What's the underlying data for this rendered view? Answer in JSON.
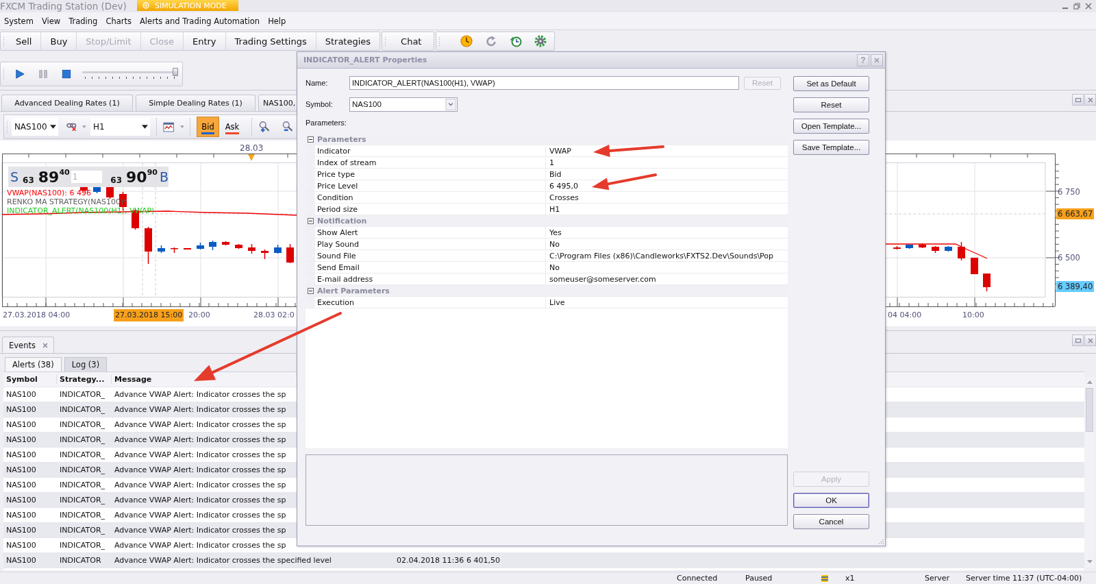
{
  "window": {
    "title": "FXCM Trading Station (Dev)",
    "mode_badge": "SIMULATION MODE"
  },
  "menu": [
    {
      "label": "System"
    },
    {
      "label": "View"
    },
    {
      "label": "Trading"
    },
    {
      "label": "Charts"
    },
    {
      "label": "Alerts and Trading Automation"
    },
    {
      "label": "Help"
    }
  ],
  "toolbar": {
    "trade_buttons": [
      {
        "label": "Sell",
        "disabled": false
      },
      {
        "label": "Buy",
        "disabled": false
      },
      {
        "label": "Stop/Limit",
        "disabled": true
      },
      {
        "label": "Close",
        "disabled": true
      },
      {
        "label": "Entry",
        "disabled": false
      },
      {
        "label": "Trading Settings",
        "disabled": false
      },
      {
        "label": "Strategies",
        "disabled": false
      }
    ],
    "chat_button": "Chat"
  },
  "playback": {
    "level": 1
  },
  "chart_panel": {
    "tabs": [
      {
        "label": "Advanced Dealing Rates (1)"
      },
      {
        "label": "Simple Dealing Rates (1)"
      },
      {
        "label": "NAS100,"
      }
    ],
    "toolbar": {
      "symbol": "NAS100",
      "period": "H1",
      "price_buttons": [
        {
          "label": "Bid",
          "selected": true
        },
        {
          "label": "Ask",
          "selected": false
        }
      ]
    },
    "date_marker": "28.03",
    "quote": {
      "sell_label": "S",
      "sell_small": "63",
      "sell_big": "89",
      "sell_pips": "40",
      "amount": "1",
      "buy_small": "63",
      "buy_big": "90",
      "buy_pips": "90",
      "buy_label": "B"
    },
    "legend": [
      {
        "text": "VWAP(NAS100): 6 496",
        "color": "#ff0000"
      },
      {
        "text": "RENKO MA STRATEGY(NAS100)*",
        "color": "#606060"
      },
      {
        "text": "INDICATOR_ALERT(NAS100(H1), VWAP)",
        "color": "#22cc22"
      }
    ],
    "price_labels": [
      {
        "text": "6 750",
        "kind": "tick"
      },
      {
        "text": "6 663,67",
        "kind": "ask"
      },
      {
        "text": "6 500",
        "kind": "tick"
      },
      {
        "text": "6 389,40",
        "kind": "bid"
      }
    ],
    "time_labels": [
      {
        "text": "27.03.2018 04:00",
        "kind": "tick"
      },
      {
        "text": "27.03.2018 15:00",
        "kind": "cursor"
      },
      {
        "text": "20:00",
        "kind": "tick"
      },
      {
        "text": "28.03 02:0",
        "kind": "tick"
      },
      {
        "text": "04 04:00",
        "kind": "tick"
      },
      {
        "text": "10:00",
        "kind": "tick"
      }
    ]
  },
  "events": {
    "panel_tab": "Events",
    "tabs": [
      {
        "label": "Alerts (38)",
        "selected": true
      },
      {
        "label": "Log (3)",
        "selected": false
      }
    ],
    "columns": [
      "Symbol",
      "Strategy...",
      "Message"
    ],
    "rows": [
      {
        "symbol": "NAS100",
        "strategy": "INDICATOR_",
        "message": "Advance VWAP Alert: Indicator crosses the sp"
      },
      {
        "symbol": "NAS100",
        "strategy": "INDICATOR_",
        "message": "Advance VWAP Alert: Indicator crosses the sp"
      },
      {
        "symbol": "NAS100",
        "strategy": "INDICATOR_",
        "message": "Advance VWAP Alert: Indicator crosses the sp"
      },
      {
        "symbol": "NAS100",
        "strategy": "INDICATOR_",
        "message": "Advance VWAP Alert: Indicator crosses the sp"
      },
      {
        "symbol": "NAS100",
        "strategy": "INDICATOR_",
        "message": "Advance VWAP Alert: Indicator crosses the sp"
      },
      {
        "symbol": "NAS100",
        "strategy": "INDICATOR_",
        "message": "Advance VWAP Alert: Indicator crosses the sp"
      },
      {
        "symbol": "NAS100",
        "strategy": "INDICATOR_",
        "message": "Advance VWAP Alert: Indicator crosses the sp"
      },
      {
        "symbol": "NAS100",
        "strategy": "INDICATOR_",
        "message": "Advance VWAP Alert: Indicator crosses the sp"
      },
      {
        "symbol": "NAS100",
        "strategy": "INDICATOR_",
        "message": "Advance VWAP Alert: Indicator crosses the sp"
      },
      {
        "symbol": "NAS100",
        "strategy": "INDICATOR_",
        "message": "Advance VWAP Alert: Indicator crosses the sp"
      },
      {
        "symbol": "NAS100",
        "strategy": "INDICATOR_",
        "message": "Advance VWAP Alert: Indicator crosses the sp"
      },
      {
        "symbol": "NAS100",
        "strategy": "INDICATOR",
        "message": "Advance VWAP Alert: Indicator crosses the specified level",
        "column_4": "02.04.2018 11:36",
        "column_5": "6 401,50"
      }
    ]
  },
  "dialog": {
    "title": "INDICATOR_ALERT Properties",
    "help_button": "?",
    "name": {
      "label": "Name:",
      "value": "INDICATOR_ALERT(NAS100(H1), VWAP)",
      "reset": {
        "label": "Reset",
        "disabled": true
      }
    },
    "symbol": {
      "label": "Symbol:",
      "value": "NAS100"
    },
    "parameters_label": "Parameters:",
    "groups": [
      {
        "title": "Parameters",
        "expanded": true,
        "rows": [
          {
            "name": "Indicator",
            "value": "VWAP"
          },
          {
            "name": "Index of stream",
            "value": "1"
          },
          {
            "name": "Price type",
            "value": "Bid"
          },
          {
            "name": "Price Level",
            "value": "6 495,0"
          },
          {
            "name": "Condition",
            "value": "Crosses"
          },
          {
            "name": "Period size",
            "value": "H1"
          }
        ]
      },
      {
        "title": "Notification",
        "expanded": true,
        "rows": [
          {
            "name": "Show Alert",
            "value": "Yes"
          },
          {
            "name": "Play Sound",
            "value": "No"
          },
          {
            "name": "Sound File",
            "value": "C:\\Program Files (x86)\\Candleworks\\FXTS2.Dev\\Sounds\\Pop"
          },
          {
            "name": "Send Email",
            "value": "No"
          },
          {
            "name": "E-mail address",
            "value": "someuser@someserver.com"
          }
        ]
      },
      {
        "title": "Alert Parameters",
        "expanded": true,
        "rows": [
          {
            "name": "Execution",
            "value": "Live"
          }
        ]
      }
    ],
    "side_buttons": [
      {
        "label": "Set as Default",
        "disabled": false
      },
      {
        "label": "Reset",
        "disabled": false
      },
      {
        "label": "Open Template...",
        "disabled": false
      },
      {
        "label": "Save Template...",
        "disabled": false
      }
    ],
    "bottom_buttons": [
      {
        "label": "Apply",
        "disabled": true,
        "default": false
      },
      {
        "label": "OK",
        "disabled": false,
        "default": true
      },
      {
        "label": "Cancel",
        "disabled": false,
        "default": false
      }
    ]
  },
  "status_bar": [
    "Connected",
    "Paused",
    "x1",
    "Server",
    "Server time 11:37 (UTC-04:00)"
  ]
}
